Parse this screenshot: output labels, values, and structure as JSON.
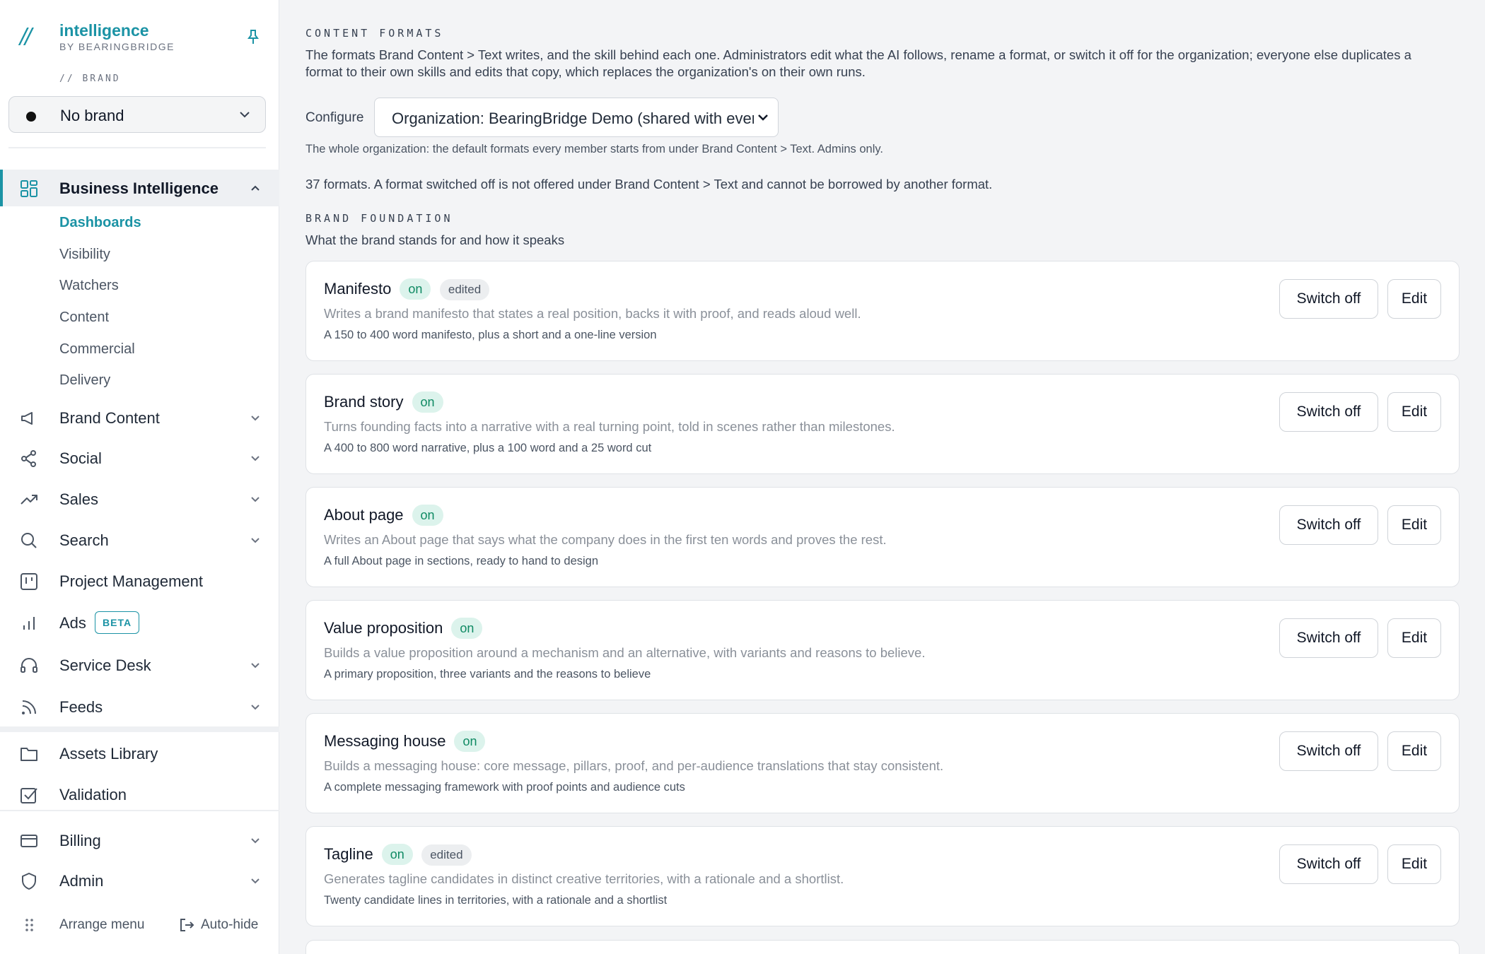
{
  "app": {
    "name": "intelligence",
    "by_line": "BY BEARINGBRIDGE",
    "logo_glyph": "//",
    "accent_color": "#1b93a5"
  },
  "sidebar": {
    "brand_section_label": "// BRAND",
    "brand_select": {
      "value": "No brand"
    },
    "nav": [
      {
        "label": "Business Intelligence",
        "icon": "dashboard-grid-icon",
        "expanded": true,
        "active": true,
        "children": [
          "Dashboards",
          "Visibility",
          "Watchers",
          "Content",
          "Commercial",
          "Delivery"
        ],
        "current_child": "Dashboards"
      },
      {
        "label": "Brand Content",
        "icon": "megaphone-icon"
      },
      {
        "label": "Social",
        "icon": "share-icon"
      },
      {
        "label": "Sales",
        "icon": "trending-up-icon"
      },
      {
        "label": "Search",
        "icon": "search-icon"
      },
      {
        "label": "Project Management",
        "icon": "kanban-icon"
      },
      {
        "label": "Ads",
        "icon": "bar-chart-icon",
        "badge": "BETA"
      },
      {
        "label": "Service Desk",
        "icon": "headset-icon"
      },
      {
        "label": "Feeds",
        "icon": "rss-icon"
      },
      {
        "label": "Assets Library",
        "icon": "folder-icon"
      },
      {
        "label": "Validation",
        "icon": "checkbox-icon"
      },
      {
        "label": "Billing",
        "icon": "credit-card-icon"
      },
      {
        "label": "Admin",
        "icon": "shield-icon"
      }
    ],
    "footer": {
      "arrange_label": "Arrange menu",
      "autohide_label": "Auto-hide"
    }
  },
  "main": {
    "heading": "CONTENT FORMATS",
    "intro_line1": "The formats Brand Content > Text writes, and the skill behind each one. Administrators edit what the AI follows, rename a format, or switch it off for the organization; everyone else duplicates a",
    "intro_line2": "format to their own skills and edits that copy, which replaces the organization's on their own runs.",
    "configure": {
      "label": "Configure",
      "value": "Organization: BearingBridge Demo (shared with everyone)",
      "note": "The whole organization: the default formats every member starts from under Brand Content > Text. Admins only."
    },
    "count_line": "37 formats. A format switched off is not offered under Brand Content > Text and cannot be borrowed by another format.",
    "section": {
      "heading": "BRAND FOUNDATION",
      "subheading": "What the brand stands for and how it speaks"
    },
    "badge_on": "on",
    "badge_edited": "edited",
    "switch_label": "Switch off",
    "edit_label": "Edit",
    "formats": [
      {
        "title": "Manifesto",
        "status": "on",
        "edited": true,
        "description": "Writes a brand manifesto that states a real position, backs it with proof, and reads aloud well.",
        "output": "A 150 to 400 word manifesto, plus a short and a one-line version"
      },
      {
        "title": "Brand story",
        "status": "on",
        "edited": false,
        "description": "Turns founding facts into a narrative with a real turning point, told in scenes rather than milestones.",
        "output": "A 400 to 800 word narrative, plus a 100 word and a 25 word cut"
      },
      {
        "title": "About page",
        "status": "on",
        "edited": false,
        "description": "Writes an About page that says what the company does in the first ten words and proves the rest.",
        "output": "A full About page in sections, ready to hand to design"
      },
      {
        "title": "Value proposition",
        "status": "on",
        "edited": false,
        "description": "Builds a value proposition around a mechanism and an alternative, with variants and reasons to believe.",
        "output": "A primary proposition, three variants and the reasons to believe"
      },
      {
        "title": "Messaging house",
        "status": "on",
        "edited": false,
        "description": "Builds a messaging house: core message, pillars, proof, and per-audience translations that stay consistent.",
        "output": "A complete messaging framework with proof points and audience cuts"
      },
      {
        "title": "Tagline",
        "status": "on",
        "edited": true,
        "description": "Generates tagline candidates in distinct creative territories, with a rationale and a shortlist.",
        "output": "Twenty candidate lines in territories, with a rationale and a shortlist"
      }
    ]
  }
}
